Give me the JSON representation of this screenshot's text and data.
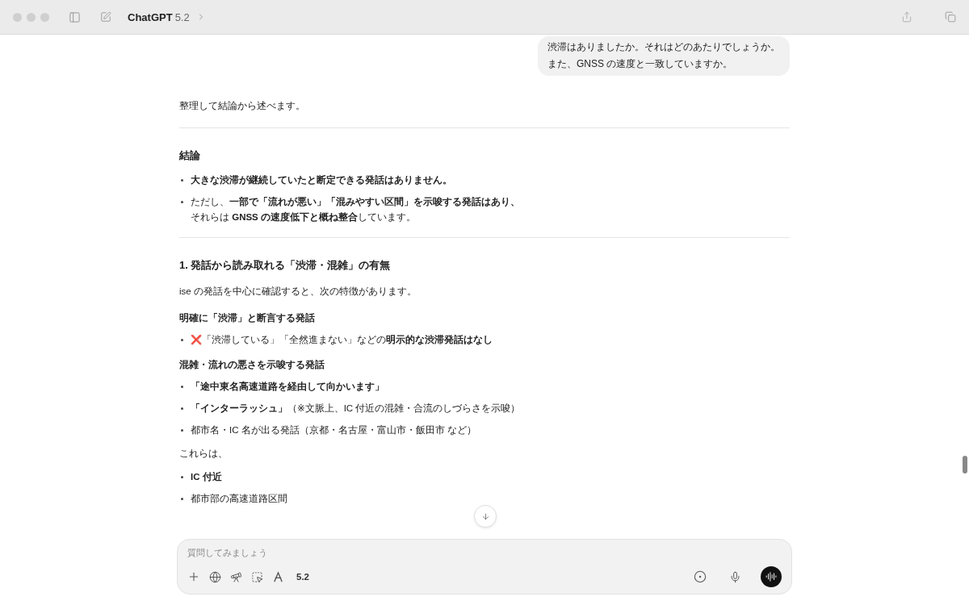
{
  "window": {
    "title": "ChatGPT",
    "model": "5.2"
  },
  "user_message": [
    "渋滞はありましたか。それはどのあたりでしょうか。",
    "また、GNSS の速度と一致していますか。"
  ],
  "answer": [
    {
      "kind": "paragraph",
      "text": "整理して結論から述べます。"
    },
    {
      "kind": "divider"
    },
    {
      "kind": "heading",
      "text": "結論"
    },
    {
      "kind": "bullet",
      "text": "**大きな渋滞が継続していたと断定できる発話はありません。**"
    },
    {
      "kind": "bullet",
      "lines": [
        "ただし、**一部で「流れが悪い」「混みやすい区間」を示唆する発話はあり、**",
        "それらは **GNSS の速度低下と概ね整合**しています。"
      ]
    },
    {
      "kind": "divider"
    },
    {
      "kind": "heading",
      "text": "1. 発話から読み取れる「渋滞・混雑」の有無"
    },
    {
      "kind": "paragraph",
      "text": "ise の発話を中心に確認すると、次の特徴があります。"
    },
    {
      "kind": "subheading",
      "text": "明確に「渋滞」と断言する発話"
    },
    {
      "kind": "bullet",
      "text": "❌「渋滞している」「全然進まない」などの**明示的な渋滞発話はなし**"
    },
    {
      "kind": "subheading",
      "text": "混雑・流れの悪さを示唆する発話"
    },
    {
      "kind": "bullet",
      "text": "**「途中東名高速道路を経由して向かいます」**"
    },
    {
      "kind": "bullet",
      "text": "**「インターラッシュ」**（※文脈上、IC 付近の混雑・合流のしづらさを示唆）"
    },
    {
      "kind": "bullet",
      "text": "都市名・IC 名が出る発話（京都・名古屋・富山市・飯田市 など）"
    },
    {
      "kind": "paragraph",
      "text": "これらは、"
    },
    {
      "kind": "bullet",
      "text": "**IC 付近**"
    },
    {
      "kind": "bullet",
      "text": "都市部の高速道路区間"
    }
  ],
  "composer": {
    "placeholder": "質問してみましょう",
    "model": "5.2"
  }
}
